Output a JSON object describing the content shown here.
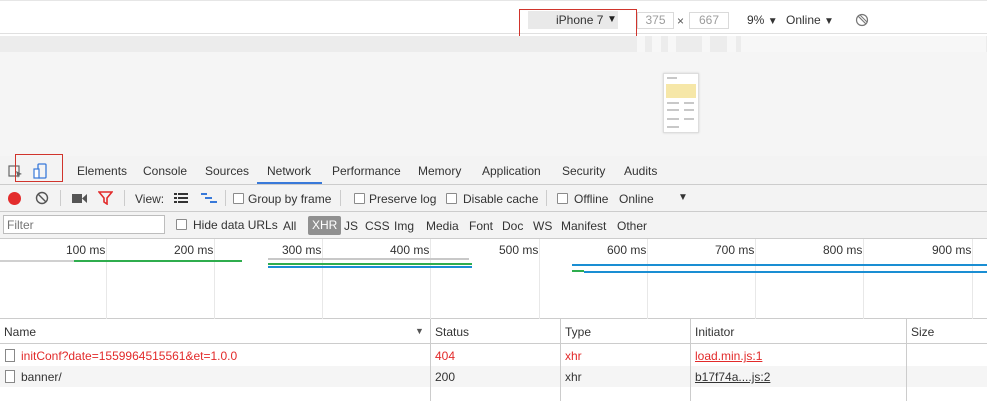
{
  "device_toolbar": {
    "device": "iPhone 7",
    "width": "375",
    "height": "667",
    "times": "×",
    "zoom": "9%",
    "network": "Online"
  },
  "tabs": [
    "Elements",
    "Console",
    "Sources",
    "Network",
    "Performance",
    "Memory",
    "Application",
    "Security",
    "Audits"
  ],
  "active_tab": "Network",
  "net_toolbar": {
    "view_label": "View:",
    "group_by_frame": "Group by frame",
    "preserve_log": "Preserve log",
    "disable_cache": "Disable cache",
    "offline": "Offline",
    "online": "Online"
  },
  "filter_bar": {
    "placeholder": "Filter",
    "hide_data_urls": "Hide data URLs",
    "types": [
      "All",
      "XHR",
      "JS",
      "CSS",
      "Img",
      "Media",
      "Font",
      "Doc",
      "WS",
      "Manifest",
      "Other"
    ],
    "active_type": "XHR"
  },
  "timeline": {
    "ticks": [
      "100 ms",
      "200 ms",
      "300 ms",
      "400 ms",
      "500 ms",
      "600 ms",
      "700 ms",
      "800 ms",
      "900 ms"
    ]
  },
  "table": {
    "columns": [
      "Name",
      "Status",
      "Type",
      "Initiator",
      "Size"
    ],
    "rows": [
      {
        "name": "initConf?date=1559964515561&et=1.0.0",
        "status": "404",
        "type": "xhr",
        "initiator": "load.min.js:1"
      },
      {
        "name": "banner/",
        "status": "200",
        "type": "xhr",
        "initiator": "b17f74a....js:2"
      }
    ]
  },
  "colors": {
    "record": "#e32c2c",
    "error_text": "#e22a2a",
    "active_tab_underline": "#3879d9",
    "highlight_box": "#d0342c",
    "timeline_green": "#2fad4e",
    "timeline_blue": "#1a8ed3"
  }
}
